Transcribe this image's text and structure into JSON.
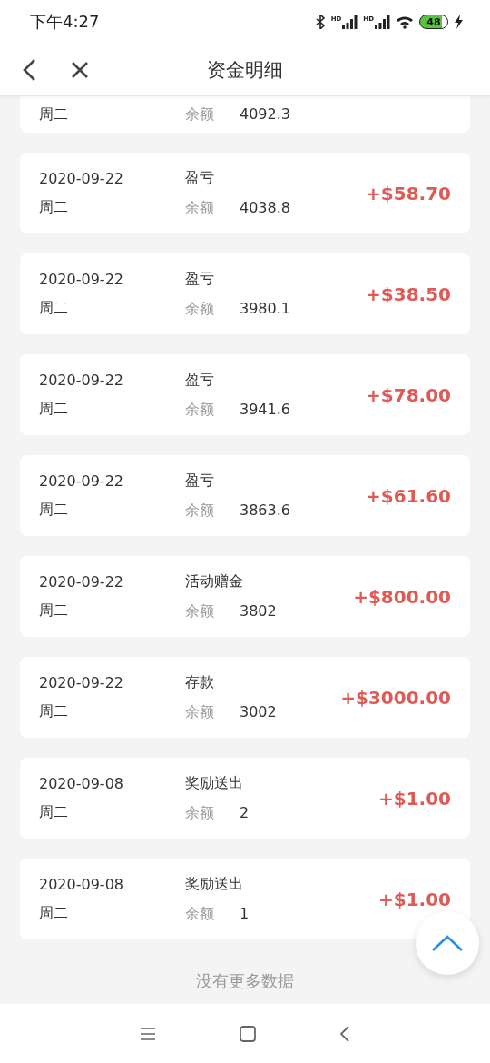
{
  "status_bar": {
    "time": "下午4:27",
    "signals": [
      {
        "label": "HD"
      },
      {
        "label": "HD"
      }
    ],
    "battery": "48"
  },
  "header": {
    "title": "资金明细"
  },
  "records": [
    {
      "kind": "partial",
      "weekday": "周二",
      "balance_label": "余额",
      "balance": "4092.3"
    },
    {
      "kind": "full",
      "date": "2020-09-22",
      "weekday": "周二",
      "type": "盈亏",
      "balance_label": "余额",
      "balance": "4038.8",
      "amount": "+$58.70"
    },
    {
      "kind": "full",
      "date": "2020-09-22",
      "weekday": "周二",
      "type": "盈亏",
      "balance_label": "余额",
      "balance": "3980.1",
      "amount": "+$38.50"
    },
    {
      "kind": "full",
      "date": "2020-09-22",
      "weekday": "周二",
      "type": "盈亏",
      "balance_label": "余额",
      "balance": "3941.6",
      "amount": "+$78.00"
    },
    {
      "kind": "full",
      "date": "2020-09-22",
      "weekday": "周二",
      "type": "盈亏",
      "balance_label": "余额",
      "balance": "3863.6",
      "amount": "+$61.60"
    },
    {
      "kind": "full",
      "date": "2020-09-22",
      "weekday": "周二",
      "type": "活动赠金",
      "balance_label": "余额",
      "balance": "3802",
      "amount": "+$800.00"
    },
    {
      "kind": "full",
      "date": "2020-09-22",
      "weekday": "周二",
      "type": "存款",
      "balance_label": "余额",
      "balance": "3002",
      "amount": "+$3000.00"
    },
    {
      "kind": "full",
      "date": "2020-09-08",
      "weekday": "周二",
      "type": "奖励送出",
      "balance_label": "余额",
      "balance": "2",
      "amount": "+$1.00"
    },
    {
      "kind": "full",
      "date": "2020-09-08",
      "weekday": "周二",
      "type": "奖励送出",
      "balance_label": "余额",
      "balance": "1",
      "amount": "+$1.00"
    }
  ],
  "footer": "没有更多数据"
}
